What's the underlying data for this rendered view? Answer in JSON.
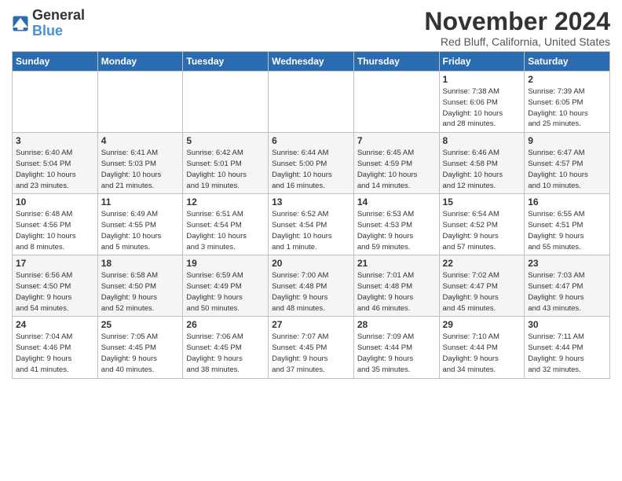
{
  "header": {
    "logo_general": "General",
    "logo_blue": "Blue",
    "title": "November 2024",
    "location": "Red Bluff, California, United States"
  },
  "weekdays": [
    "Sunday",
    "Monday",
    "Tuesday",
    "Wednesday",
    "Thursday",
    "Friday",
    "Saturday"
  ],
  "weeks": [
    [
      {
        "day": "",
        "info": ""
      },
      {
        "day": "",
        "info": ""
      },
      {
        "day": "",
        "info": ""
      },
      {
        "day": "",
        "info": ""
      },
      {
        "day": "",
        "info": ""
      },
      {
        "day": "1",
        "info": "Sunrise: 7:38 AM\nSunset: 6:06 PM\nDaylight: 10 hours\nand 28 minutes."
      },
      {
        "day": "2",
        "info": "Sunrise: 7:39 AM\nSunset: 6:05 PM\nDaylight: 10 hours\nand 25 minutes."
      }
    ],
    [
      {
        "day": "3",
        "info": "Sunrise: 6:40 AM\nSunset: 5:04 PM\nDaylight: 10 hours\nand 23 minutes."
      },
      {
        "day": "4",
        "info": "Sunrise: 6:41 AM\nSunset: 5:03 PM\nDaylight: 10 hours\nand 21 minutes."
      },
      {
        "day": "5",
        "info": "Sunrise: 6:42 AM\nSunset: 5:01 PM\nDaylight: 10 hours\nand 19 minutes."
      },
      {
        "day": "6",
        "info": "Sunrise: 6:44 AM\nSunset: 5:00 PM\nDaylight: 10 hours\nand 16 minutes."
      },
      {
        "day": "7",
        "info": "Sunrise: 6:45 AM\nSunset: 4:59 PM\nDaylight: 10 hours\nand 14 minutes."
      },
      {
        "day": "8",
        "info": "Sunrise: 6:46 AM\nSunset: 4:58 PM\nDaylight: 10 hours\nand 12 minutes."
      },
      {
        "day": "9",
        "info": "Sunrise: 6:47 AM\nSunset: 4:57 PM\nDaylight: 10 hours\nand 10 minutes."
      }
    ],
    [
      {
        "day": "10",
        "info": "Sunrise: 6:48 AM\nSunset: 4:56 PM\nDaylight: 10 hours\nand 8 minutes."
      },
      {
        "day": "11",
        "info": "Sunrise: 6:49 AM\nSunset: 4:55 PM\nDaylight: 10 hours\nand 5 minutes."
      },
      {
        "day": "12",
        "info": "Sunrise: 6:51 AM\nSunset: 4:54 PM\nDaylight: 10 hours\nand 3 minutes."
      },
      {
        "day": "13",
        "info": "Sunrise: 6:52 AM\nSunset: 4:54 PM\nDaylight: 10 hours\nand 1 minute."
      },
      {
        "day": "14",
        "info": "Sunrise: 6:53 AM\nSunset: 4:53 PM\nDaylight: 9 hours\nand 59 minutes."
      },
      {
        "day": "15",
        "info": "Sunrise: 6:54 AM\nSunset: 4:52 PM\nDaylight: 9 hours\nand 57 minutes."
      },
      {
        "day": "16",
        "info": "Sunrise: 6:55 AM\nSunset: 4:51 PM\nDaylight: 9 hours\nand 55 minutes."
      }
    ],
    [
      {
        "day": "17",
        "info": "Sunrise: 6:56 AM\nSunset: 4:50 PM\nDaylight: 9 hours\nand 54 minutes."
      },
      {
        "day": "18",
        "info": "Sunrise: 6:58 AM\nSunset: 4:50 PM\nDaylight: 9 hours\nand 52 minutes."
      },
      {
        "day": "19",
        "info": "Sunrise: 6:59 AM\nSunset: 4:49 PM\nDaylight: 9 hours\nand 50 minutes."
      },
      {
        "day": "20",
        "info": "Sunrise: 7:00 AM\nSunset: 4:48 PM\nDaylight: 9 hours\nand 48 minutes."
      },
      {
        "day": "21",
        "info": "Sunrise: 7:01 AM\nSunset: 4:48 PM\nDaylight: 9 hours\nand 46 minutes."
      },
      {
        "day": "22",
        "info": "Sunrise: 7:02 AM\nSunset: 4:47 PM\nDaylight: 9 hours\nand 45 minutes."
      },
      {
        "day": "23",
        "info": "Sunrise: 7:03 AM\nSunset: 4:47 PM\nDaylight: 9 hours\nand 43 minutes."
      }
    ],
    [
      {
        "day": "24",
        "info": "Sunrise: 7:04 AM\nSunset: 4:46 PM\nDaylight: 9 hours\nand 41 minutes."
      },
      {
        "day": "25",
        "info": "Sunrise: 7:05 AM\nSunset: 4:45 PM\nDaylight: 9 hours\nand 40 minutes."
      },
      {
        "day": "26",
        "info": "Sunrise: 7:06 AM\nSunset: 4:45 PM\nDaylight: 9 hours\nand 38 minutes."
      },
      {
        "day": "27",
        "info": "Sunrise: 7:07 AM\nSunset: 4:45 PM\nDaylight: 9 hours\nand 37 minutes."
      },
      {
        "day": "28",
        "info": "Sunrise: 7:09 AM\nSunset: 4:44 PM\nDaylight: 9 hours\nand 35 minutes."
      },
      {
        "day": "29",
        "info": "Sunrise: 7:10 AM\nSunset: 4:44 PM\nDaylight: 9 hours\nand 34 minutes."
      },
      {
        "day": "30",
        "info": "Sunrise: 7:11 AM\nSunset: 4:44 PM\nDaylight: 9 hours\nand 32 minutes."
      }
    ]
  ]
}
